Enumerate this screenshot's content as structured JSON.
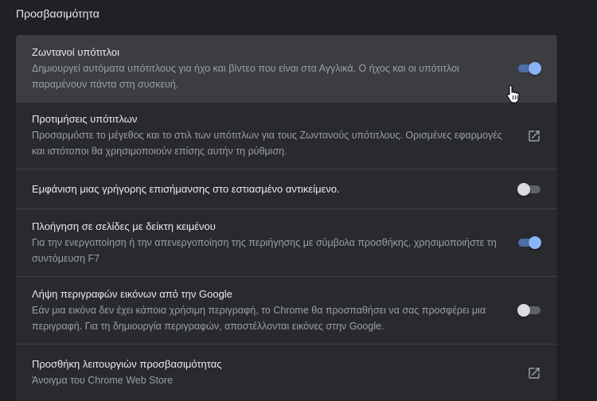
{
  "section": {
    "title": "Προσβασιμότητα"
  },
  "rows": [
    {
      "title": "Ζωντανοί υπότιτλοι",
      "subtitle": "Δημιουργεί αυτόματα υπότιτλους για ήχο και βίντεο που είναι στα Αγγλικά. Ο ήχος και οι υπότιτλοι παραμένουν πάντα στη συσκευή.",
      "control": "toggle",
      "checked": true
    },
    {
      "title": "Προτιμήσεις υπότιτλων",
      "subtitle": "Προσαρμόστε το μέγεθος και το στιλ των υπότιτλων για τους Ζωντανούς υπότιτλους. Ορισμένες εφαρμογές και ιστότοποι θα χρησιμοποιούν επίσης αυτήν τη ρύθμιση.",
      "control": "external-link",
      "icon": "open-in-new-icon"
    },
    {
      "title": "Εμφάνιση μιας γρήγορης επισήμανσης στο εστιασμένο αντικείμενο.",
      "control": "toggle",
      "checked": false
    },
    {
      "title": "Πλοήγηση σε σελίδες με δείκτη κειμένου",
      "subtitle": "Για την ενεργοποίηση ή την απενεργοποίηση της περιήγησης με σύμβολα προσθήκης, χρησιμοποιήστε τη συντόμευση F7",
      "control": "toggle",
      "checked": true
    },
    {
      "title": "Λήψη περιγραφών εικόνων από την Google",
      "subtitle": "Εάν μια εικόνα δεν έχει κάποια χρήσιμη περιγραφή, το Chrome θα προσπαθήσει να σας προσφέρει μια περιγραφή. Για τη δημιουργία περιγραφών, αποστέλλονται εικόνες στην Google.",
      "control": "toggle",
      "checked": false
    },
    {
      "title": "Προσθήκη λειτουργιών προσβασιμότητας",
      "subtitle": "Άνοιγμα του Chrome Web Store",
      "control": "external-link",
      "icon": "open-in-new-icon"
    }
  ],
  "colors": {
    "background": "#202124",
    "card": "#292a2d",
    "hover_row": "#3c3d40",
    "toggle_on_knob": "#8ab4f8",
    "toggle_on_track": "#4b6fa6",
    "toggle_off_knob": "#dadce0",
    "toggle_off_track": "#5f6368",
    "secondary_text": "#9aa0a6"
  }
}
